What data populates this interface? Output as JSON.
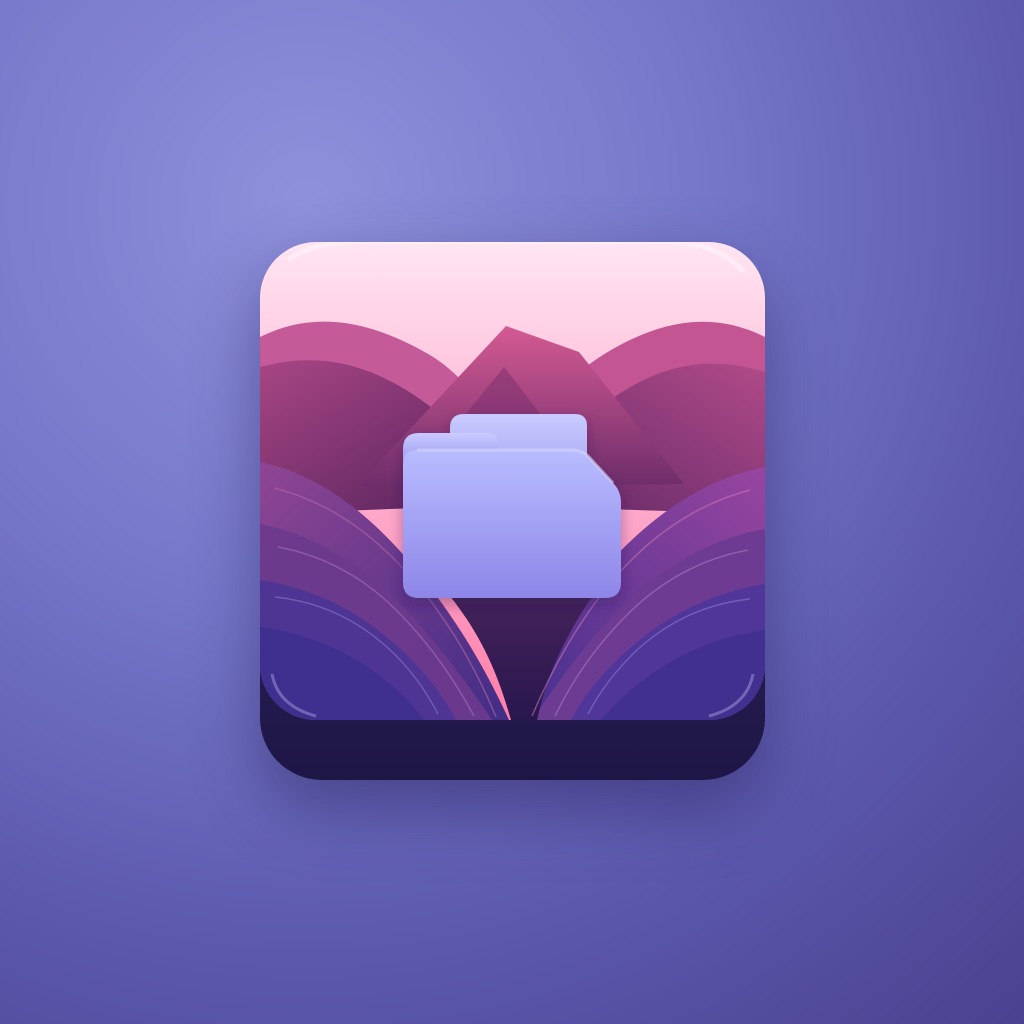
{
  "scene": {
    "background_color": "#7073c7",
    "accent_color": "#a67fe0",
    "app_icon": {
      "name": "folder-app-icon",
      "colors": {
        "sky_top": "#ffe1f0",
        "sky_bottom": "#ff8fb8",
        "mountain_light": "#c44f87",
        "mountain_dark": "#5d2d6a",
        "front_hills": "#7c3a87",
        "folder": "#aeb0ff",
        "base": "#2b1e56"
      },
      "icons": [
        "folder-icon",
        "mountain-icon"
      ]
    }
  }
}
